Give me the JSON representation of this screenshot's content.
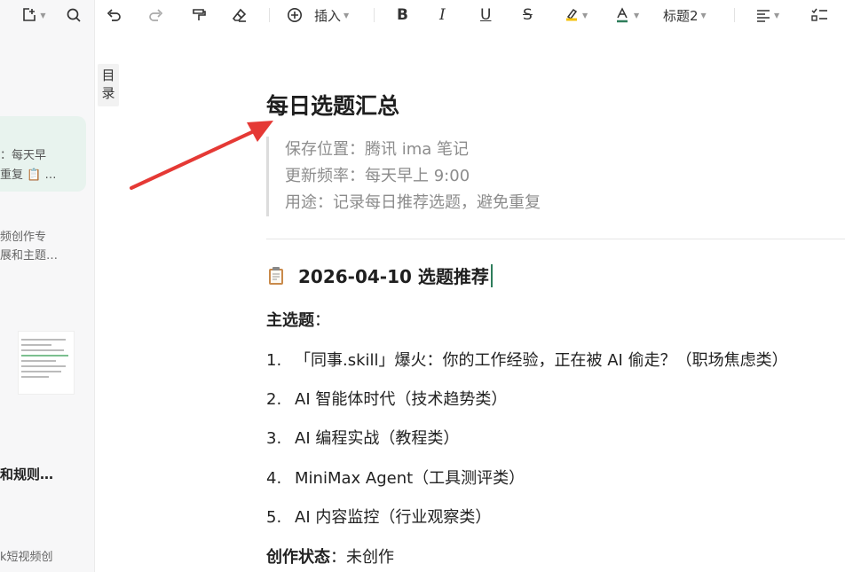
{
  "sidebar": {
    "snippets": [
      {
        "text": "：每天早",
        "class": "dark"
      },
      {
        "text": "重复 📋 …",
        "class": "dark"
      },
      {
        "text": "频创作专",
        "class": ""
      },
      {
        "text": "展和主题…",
        "class": ""
      },
      {
        "text": "和规则…",
        "class": "title"
      },
      {
        "text": "k短视频创",
        "class": ""
      }
    ]
  },
  "toolbar": {
    "insert_label": "插入",
    "heading_label": "标题2"
  },
  "toc_label": "目录",
  "doc": {
    "title": "每日选题汇总",
    "quote_lines": [
      "保存位置：腾讯 ima 笔记",
      "更新频率：每天早上 9:00",
      "用途：记录每日推荐选题，避免重复"
    ],
    "section_heading": "2026-04-10 选题推荐",
    "main_topics_label": "主选题",
    "main_topics_colon": "：",
    "topics": [
      {
        "num": "1.",
        "text": "「同事.skill」爆火：你的工作经验，正在被 AI 偷走？（职场焦虑类）"
      },
      {
        "num": "2.",
        "text": "AI 智能体时代（技术趋势类）"
      },
      {
        "num": "3.",
        "text": "AI 编程实战（教程类）"
      },
      {
        "num": "4.",
        "text": "MiniMax Agent（工具测评类）"
      },
      {
        "num": "5.",
        "text": "AI 内容监控（行业观察类）"
      }
    ],
    "status_label": "创作状态",
    "status_colon": "：",
    "status_value": "未创作"
  },
  "colors": {
    "accent_green": "#2e7d5b",
    "active_card": "#e8f3ee",
    "arrow_red": "#e53935"
  }
}
